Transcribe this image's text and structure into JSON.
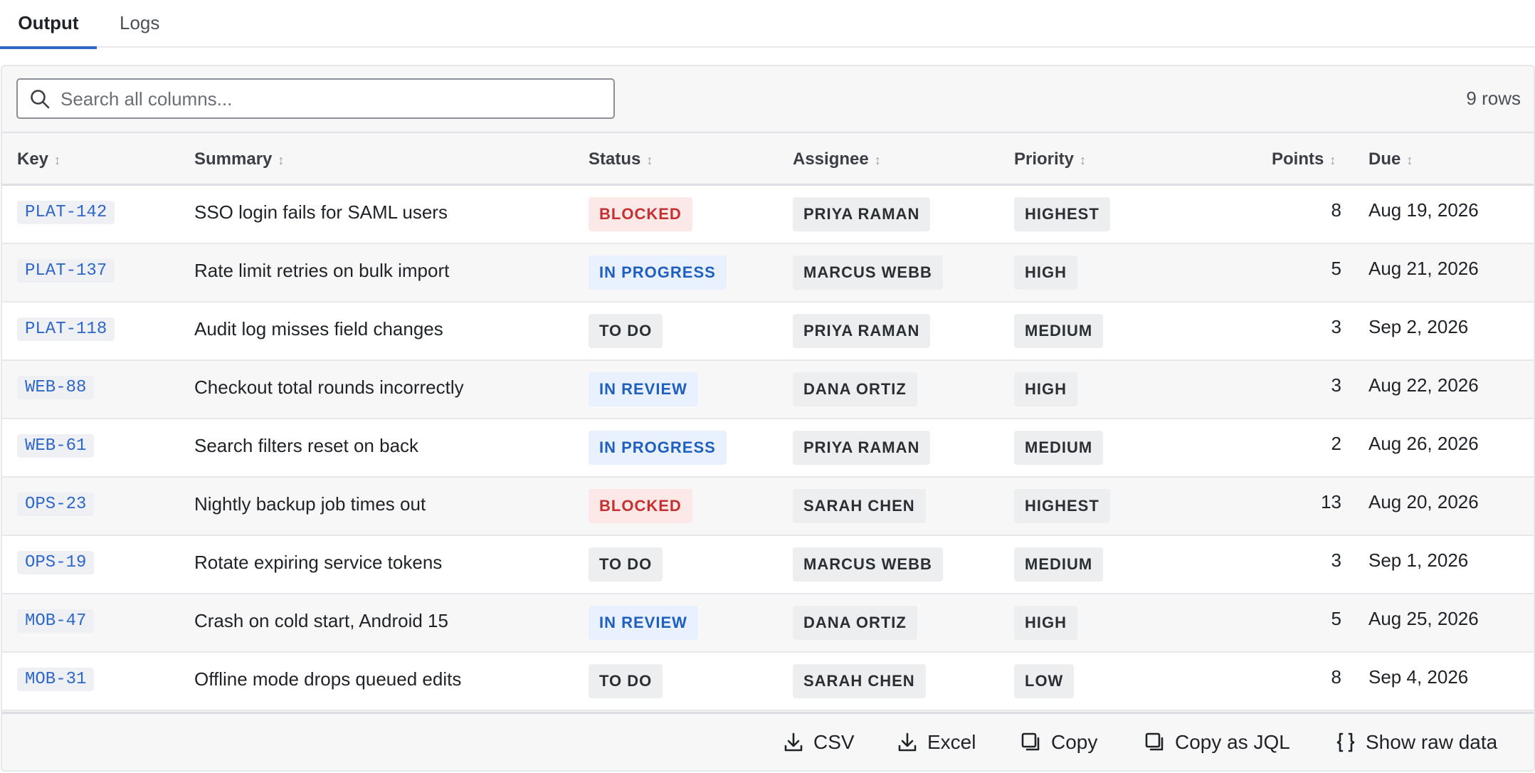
{
  "tabs": [
    {
      "label": "Output",
      "active": true
    },
    {
      "label": "Logs",
      "active": false
    }
  ],
  "search": {
    "placeholder": "Search all columns...",
    "value": ""
  },
  "row_count": "9 rows",
  "columns": [
    "Key",
    "Summary",
    "Status",
    "Assignee",
    "Priority",
    "Points",
    "Due"
  ],
  "rows": [
    {
      "key": "PLAT-142",
      "summary": "SSO login fails for SAML users",
      "status": "BLOCKED",
      "assignee": "PRIYA RAMAN",
      "priority": "HIGHEST",
      "points": "8",
      "due": "Aug 19, 2026"
    },
    {
      "key": "PLAT-137",
      "summary": "Rate limit retries on bulk import",
      "status": "IN PROGRESS",
      "assignee": "MARCUS WEBB",
      "priority": "HIGH",
      "points": "5",
      "due": "Aug 21, 2026"
    },
    {
      "key": "PLAT-118",
      "summary": "Audit log misses field changes",
      "status": "TO DO",
      "assignee": "PRIYA RAMAN",
      "priority": "MEDIUM",
      "points": "3",
      "due": "Sep 2, 2026"
    },
    {
      "key": "WEB-88",
      "summary": "Checkout total rounds incorrectly",
      "status": "IN REVIEW",
      "assignee": "DANA ORTIZ",
      "priority": "HIGH",
      "points": "3",
      "due": "Aug 22, 2026"
    },
    {
      "key": "WEB-61",
      "summary": "Search filters reset on back",
      "status": "IN PROGRESS",
      "assignee": "PRIYA RAMAN",
      "priority": "MEDIUM",
      "points": "2",
      "due": "Aug 26, 2026"
    },
    {
      "key": "OPS-23",
      "summary": "Nightly backup job times out",
      "status": "BLOCKED",
      "assignee": "SARAH CHEN",
      "priority": "HIGHEST",
      "points": "13",
      "due": "Aug 20, 2026"
    },
    {
      "key": "OPS-19",
      "summary": "Rotate expiring service tokens",
      "status": "TO DO",
      "assignee": "MARCUS WEBB",
      "priority": "MEDIUM",
      "points": "3",
      "due": "Sep 1, 2026"
    },
    {
      "key": "MOB-47",
      "summary": "Crash on cold start, Android 15",
      "status": "IN REVIEW",
      "assignee": "DANA ORTIZ",
      "priority": "HIGH",
      "points": "5",
      "due": "Aug 25, 2026"
    },
    {
      "key": "MOB-31",
      "summary": "Offline mode drops queued edits",
      "status": "TO DO",
      "assignee": "SARAH CHEN",
      "priority": "LOW",
      "points": "8",
      "due": "Sep 4, 2026"
    }
  ],
  "footer": {
    "csv": "CSV",
    "excel": "Excel",
    "copy": "Copy",
    "copy_jql": "Copy as JQL",
    "raw": "Show raw data"
  },
  "colors": {
    "accent": "#2f67c9",
    "blocked_bg": "#fde8e8",
    "blocked_fg": "#c53030",
    "progress_bg": "#e8f1fd",
    "progress_fg": "#1f5fbf",
    "neutral_bg": "#eceef0"
  },
  "icons": {
    "search": "search-icon",
    "sort": "sort-icon",
    "download": "download-icon",
    "copy": "copy-icon",
    "braces": "braces-icon"
  }
}
